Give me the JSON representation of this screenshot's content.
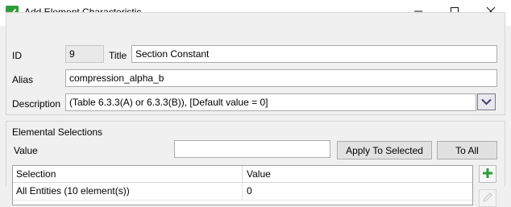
{
  "window": {
    "title": "Add Element Characteristic",
    "icon": "green-check-icon",
    "controls": [
      "minimize-icon",
      "maximize-icon",
      "close-icon"
    ]
  },
  "form": {
    "id_label": "ID",
    "id_value": "9",
    "title_label": "Title",
    "title_value": "Section Constant",
    "alias_label": "Alias",
    "alias_value": "compression_alpha_b",
    "description_label": "Description",
    "description_value": "(Table 6.3.3(A) or 6.3.3(B)), [Default value = 0]"
  },
  "selections": {
    "group_label": "Elemental Selections",
    "value_label": "Value",
    "value_input": "",
    "apply_button": "Apply To Selected",
    "to_all_button": "To All",
    "columns": [
      "Selection",
      "Value"
    ],
    "rows": [
      {
        "selection": "All Entities (10 element(s))",
        "value": "0"
      }
    ]
  },
  "colors": {
    "accent_green": "#2e9c3a",
    "dropdown_arrow": "#4a3b6b"
  }
}
